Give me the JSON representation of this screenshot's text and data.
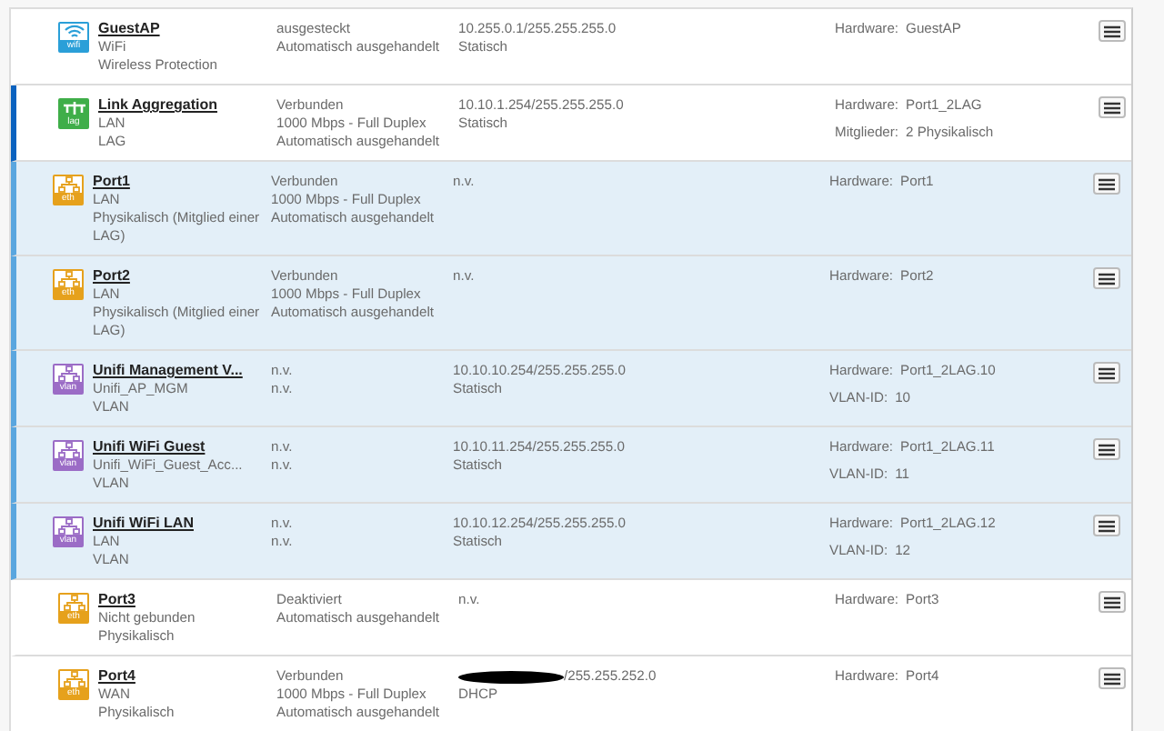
{
  "interfaces": [
    {
      "kind": "plain",
      "type": "wifi",
      "name": "GuestAP",
      "details": [
        "WiFi",
        "Wireless Protection"
      ],
      "status": [
        "ausgesteckt",
        "Automatisch ausgehandelt"
      ],
      "ip": [
        "10.255.0.1/255.255.255.0",
        "Statisch"
      ],
      "hardware": [
        {
          "label": "Hardware:",
          "value": "GuestAP"
        }
      ]
    },
    {
      "kind": "parent",
      "type": "lag",
      "name": "Link Aggregation",
      "details": [
        "LAN",
        "LAG"
      ],
      "status": [
        "Verbunden",
        "1000 Mbps - Full Duplex",
        "Automatisch ausgehandelt"
      ],
      "ip": [
        "10.10.1.254/255.255.255.0",
        "Statisch"
      ],
      "hardware": [
        {
          "label": "Hardware:",
          "value": "Port1_2LAG"
        },
        {
          "label": "Mitglieder:",
          "value": "2 Physikalisch"
        }
      ]
    },
    {
      "kind": "member",
      "type": "eth",
      "name": "Port1",
      "details": [
        "LAN",
        "Physikalisch (Mitglied einer LAG)"
      ],
      "status": [
        "Verbunden",
        "1000 Mbps - Full Duplex",
        "Automatisch ausgehandelt"
      ],
      "ip": [
        "n.v."
      ],
      "hardware": [
        {
          "label": "Hardware:",
          "value": "Port1"
        }
      ]
    },
    {
      "kind": "member",
      "type": "eth",
      "name": "Port2",
      "details": [
        "LAN",
        "Physikalisch (Mitglied einer LAG)"
      ],
      "status": [
        "Verbunden",
        "1000 Mbps - Full Duplex",
        "Automatisch ausgehandelt"
      ],
      "ip": [
        "n.v."
      ],
      "hardware": [
        {
          "label": "Hardware:",
          "value": "Port2"
        }
      ]
    },
    {
      "kind": "member",
      "type": "vlan",
      "name": "Unifi Management V...",
      "details": [
        "Unifi_AP_MGM",
        "VLAN"
      ],
      "status": [
        "n.v.",
        "n.v."
      ],
      "ip": [
        "10.10.10.254/255.255.255.0",
        "Statisch"
      ],
      "hardware": [
        {
          "label": "Hardware:",
          "value": "Port1_2LAG.10"
        },
        {
          "label": "VLAN-ID:",
          "value": "10"
        }
      ]
    },
    {
      "kind": "member",
      "type": "vlan",
      "name": "Unifi WiFi Guest",
      "details": [
        "Unifi_WiFi_Guest_Acc...",
        "VLAN"
      ],
      "status": [
        "n.v.",
        "n.v."
      ],
      "ip": [
        "10.10.11.254/255.255.255.0",
        "Statisch"
      ],
      "hardware": [
        {
          "label": "Hardware:",
          "value": "Port1_2LAG.11"
        },
        {
          "label": "VLAN-ID:",
          "value": "11"
        }
      ]
    },
    {
      "kind": "member",
      "type": "vlan",
      "name": "Unifi WiFi LAN",
      "details": [
        "LAN",
        "VLAN"
      ],
      "status": [
        "n.v.",
        "n.v."
      ],
      "ip": [
        "10.10.12.254/255.255.255.0",
        "Statisch"
      ],
      "hardware": [
        {
          "label": "Hardware:",
          "value": "Port1_2LAG.12"
        },
        {
          "label": "VLAN-ID:",
          "value": "12"
        }
      ]
    },
    {
      "kind": "plain",
      "type": "eth",
      "name": "Port3",
      "details": [
        "Nicht gebunden",
        "Physikalisch"
      ],
      "status": [
        "Deaktiviert",
        "Automatisch ausgehandelt"
      ],
      "ip": [
        "n.v."
      ],
      "hardware": [
        {
          "label": "Hardware:",
          "value": "Port3"
        }
      ]
    },
    {
      "kind": "plain",
      "type": "eth",
      "name": "Port4",
      "details": [
        "WAN",
        "Physikalisch"
      ],
      "status": [
        "Verbunden",
        "1000 Mbps - Full Duplex",
        "Automatisch ausgehandelt"
      ],
      "ip": [
        "/255.255.252.0",
        "DHCP"
      ],
      "ip_redacted": true,
      "hardware": [
        {
          "label": "Hardware:",
          "value": "Port4"
        }
      ]
    }
  ]
}
